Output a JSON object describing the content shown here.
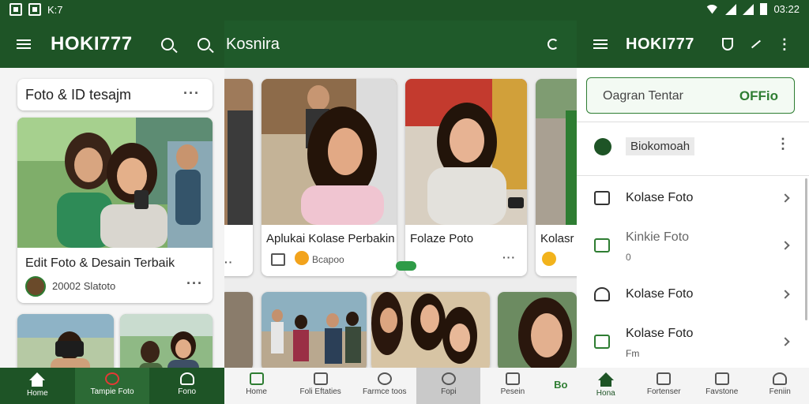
{
  "status_bar": {
    "left_text": "K:7",
    "time": "03:22"
  },
  "left_panel": {
    "brand": "HOKI777",
    "card_header": "Foto & ID tesajm",
    "main_card": {
      "title": "Edit Foto & Desain Terbaik",
      "meta": "20002 Slatoto"
    },
    "nav": [
      {
        "label": "Home",
        "icon": "home-icon"
      },
      {
        "label": "Tampie Foto",
        "icon": "clock-icon"
      },
      {
        "label": "Fono",
        "icon": "person-icon"
      }
    ]
  },
  "middle_panel": {
    "title": "Kosnira",
    "cards": [
      {
        "title": "Aplukai Kolase Perbakin",
        "meta": "Bcapoo"
      },
      {
        "title": "Folaze Poto",
        "meta": ""
      },
      {
        "title": "Kolasr",
        "meta": ""
      }
    ],
    "nav": [
      {
        "label": "Home",
        "icon": "home-icon"
      },
      {
        "label": "Foli Eftaties",
        "icon": "grid-icon"
      },
      {
        "label": "Farmce toos",
        "icon": "clock-icon"
      },
      {
        "label": "Fopi",
        "icon": "search-icon"
      },
      {
        "label": "Pesein",
        "icon": "star-icon"
      },
      {
        "label": "Bo",
        "icon": ""
      }
    ]
  },
  "right_panel": {
    "brand": "HOKI777",
    "search": {
      "placeholder": "Oagran Tentar",
      "action": "OFFio"
    },
    "profile_text": "Biokomoah",
    "menu": [
      {
        "label": "Kolase Foto",
        "sub": "",
        "icon": "layout-icon"
      },
      {
        "label": "Kinkie Foto",
        "sub": "0",
        "icon": "image-icon"
      },
      {
        "label": "Kolase Foto",
        "sub": "",
        "icon": "home-icon"
      },
      {
        "label": "Kolase Foto",
        "sub": "Fm",
        "icon": "document-icon"
      }
    ],
    "nav": [
      {
        "label": "Hona",
        "icon": "home-icon"
      },
      {
        "label": "Fortenser",
        "icon": "shield-icon"
      },
      {
        "label": "Favstone",
        "icon": "card-icon"
      },
      {
        "label": "Feniin",
        "icon": "person-icon"
      }
    ]
  },
  "colors": {
    "primary": "#1e5426",
    "accent": "#2e7d32",
    "surface": "#ffffff",
    "background": "#f2f2f2"
  }
}
